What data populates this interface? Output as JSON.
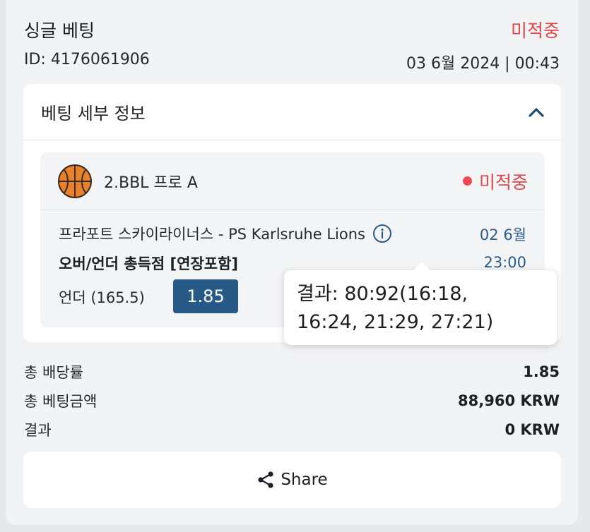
{
  "header": {
    "title": "싱글 베팅",
    "status": "미적중",
    "id_text": "ID: 4176061906",
    "datetime": "03 6월 2024 | 00:43"
  },
  "details": {
    "title": "베팅 세부 정보",
    "league": "2.BBL 프로 A",
    "status": "미적중",
    "match": "프라포트 스카이라이너스 - PS Karlsruhe Lions",
    "date": "02 6월",
    "time": "23:00",
    "market": "오버/언더 총득점 [연장포함]",
    "pick": "언더 (165.5)",
    "odds": "1.85"
  },
  "tooltip": {
    "line1": "결과: 80:92(16:18,",
    "line2": "16:24, 21:29, 27:21)"
  },
  "summary": [
    {
      "label": "총 배당률",
      "value": "1.85"
    },
    {
      "label": "총 베팅금액",
      "value": "88,960 KRW"
    },
    {
      "label": "결과",
      "value": "0 KRW"
    }
  ],
  "share": {
    "label": "Share"
  },
  "icons": {
    "sport": "basketball-icon",
    "collapse": "chevron-up-icon",
    "info": "info-icon",
    "share": "share-icon"
  },
  "colors": {
    "status_red": "#e2454c",
    "accent_blue": "#275a87",
    "date_blue": "#2b5b88"
  }
}
